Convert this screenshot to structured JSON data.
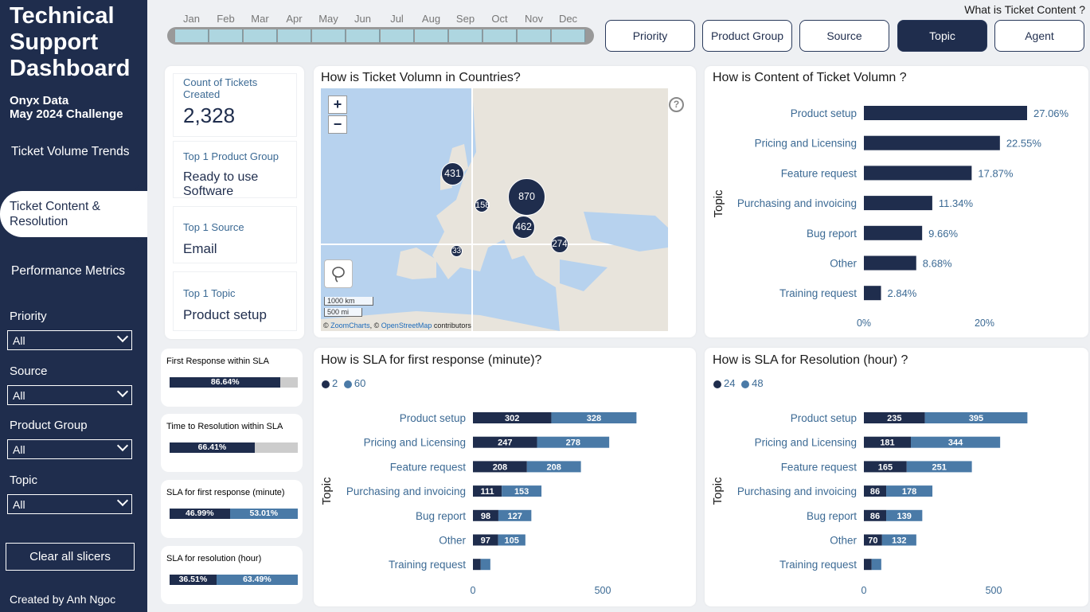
{
  "sidebar": {
    "title": "Technical Support Dashboard",
    "title_lines": [
      "Technical",
      "Support",
      "Dashboard"
    ],
    "sub1": "Onyx Data",
    "sub2": "May 2024 Challenge",
    "nav": [
      "Ticket Volume Trends",
      "Ticket Content & Resolution",
      "Performance Metrics"
    ],
    "slicers": [
      {
        "label": "Priority",
        "value": "All"
      },
      {
        "label": "Source",
        "value": "All"
      },
      {
        "label": "Product Group",
        "value": "All"
      },
      {
        "label": "Topic",
        "value": "All"
      }
    ],
    "clear_label": "Clear all slicers",
    "credit": "Created by Anh Ngoc"
  },
  "months": [
    "Jan",
    "Feb",
    "Mar",
    "Apr",
    "May",
    "Jun",
    "Jul",
    "Aug",
    "Sep",
    "Oct",
    "Nov",
    "Dec"
  ],
  "question": "What is Ticket Content ?",
  "tabs": [
    "Priority",
    "Product Group",
    "Source",
    "Topic",
    "Agent"
  ],
  "selected_tab": "Topic",
  "kpis": [
    {
      "label": "Count of Tickets Created",
      "value": "2,328"
    },
    {
      "label": "Top 1 Product Group",
      "value": "Ready to use Software"
    },
    {
      "label": "Top 1 Source",
      "value": "Email"
    },
    {
      "label": "Top 1 Topic",
      "value": "Product setup"
    }
  ],
  "sla_cards": [
    {
      "label": "First Response within SLA",
      "segments": [
        {
          "text": "86.64%",
          "pct": 86.64,
          "color": "#1f2d4d"
        }
      ]
    },
    {
      "label": "Time to Resolution within SLA",
      "segments": [
        {
          "text": "66.41%",
          "pct": 66.41,
          "color": "#1f2d4d"
        }
      ]
    },
    {
      "label": "SLA for first response (minute)",
      "segments": [
        {
          "text": "46.99%",
          "pct": 46.99,
          "color": "#1f2d4d"
        },
        {
          "text": "53.01%",
          "pct": 53.01,
          "color": "#4a7aa7"
        }
      ]
    },
    {
      "label": "SLA for resolution (hour)",
      "segments": [
        {
          "text": "36.51%",
          "pct": 36.51,
          "color": "#1f2d4d"
        },
        {
          "text": "63.49%",
          "pct": 63.49,
          "color": "#4a7aa7"
        }
      ]
    }
  ],
  "map": {
    "title": "How is Ticket Volumn in Countries?",
    "zoom_in": "+",
    "zoom_out": "−",
    "help": "?",
    "scale_km": "1000 km",
    "scale_mi": "500 mi",
    "attribution_prefix": "© ",
    "attribution_zc": "ZoomCharts",
    "attribution_mid": ", © ",
    "attribution_osm": "OpenStreetMap",
    "attribution_suffix": " contributors",
    "bubbles": [
      "431",
      "158",
      "870",
      "462",
      "274",
      "33"
    ]
  },
  "chart_data": [
    {
      "type": "bar",
      "title": "How is Content of Ticket Volumn ?",
      "ylabel": "Topic",
      "categories": [
        "Product setup",
        "Pricing and Licensing",
        "Feature request",
        "Purchasing and invoicing",
        "Bug report",
        "Other",
        "Training request"
      ],
      "values": [
        27.06,
        22.55,
        17.87,
        11.34,
        9.66,
        8.68,
        2.84
      ],
      "labels": [
        "27.06%",
        "22.55%",
        "17.87%",
        "11.34%",
        "9.66%",
        "8.68%",
        "2.84%"
      ],
      "xticks": [
        "0%",
        "20%"
      ],
      "xlim": [
        0,
        30
      ]
    },
    {
      "type": "bar",
      "stacked": true,
      "title": "How is SLA for first response (minute)?",
      "ylabel": "Topic",
      "legend": [
        "2",
        "60"
      ],
      "categories": [
        "Product setup",
        "Pricing and Licensing",
        "Feature request",
        "Purchasing and invoicing",
        "Bug report",
        "Other",
        "Training request"
      ],
      "series": [
        {
          "name": "2",
          "color": "#1f2d4d",
          "values": [
            302,
            247,
            208,
            111,
            98,
            97,
            30
          ]
        },
        {
          "name": "60",
          "color": "#4a7aa7",
          "values": [
            328,
            278,
            208,
            153,
            127,
            105,
            37
          ]
        }
      ],
      "xticks": [
        "0",
        "500"
      ],
      "xlim": [
        0,
        500
      ]
    },
    {
      "type": "bar",
      "stacked": true,
      "title": "How is SLA for Resolution (hour) ?",
      "ylabel": "Topic",
      "legend": [
        "24",
        "48"
      ],
      "categories": [
        "Product setup",
        "Pricing and Licensing",
        "Feature request",
        "Purchasing and invoicing",
        "Bug report",
        "Other",
        "Training request"
      ],
      "series": [
        {
          "name": "24",
          "color": "#1f2d4d",
          "values": [
            235,
            181,
            165,
            86,
            86,
            70,
            30
          ]
        },
        {
          "name": "48",
          "color": "#4a7aa7",
          "values": [
            395,
            344,
            251,
            178,
            139,
            132,
            37
          ]
        }
      ],
      "xticks": [
        "0",
        "500"
      ],
      "xlim": [
        0,
        500
      ]
    }
  ]
}
